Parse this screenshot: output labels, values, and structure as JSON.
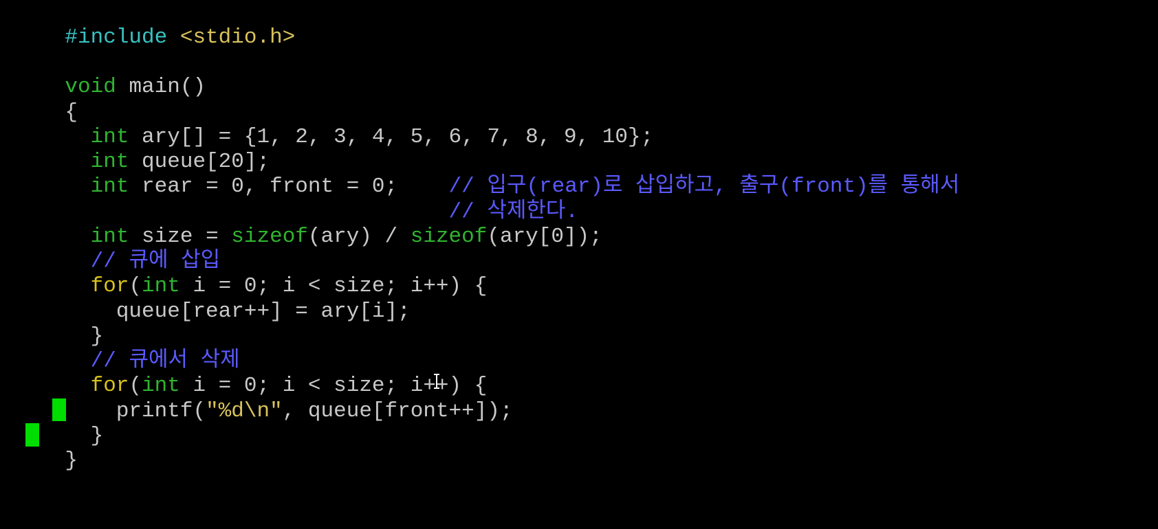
{
  "editor": {
    "lines": [
      {
        "parts": [
          "#include",
          " <stdio.h>"
        ]
      },
      {
        "parts": []
      },
      {
        "parts": [
          "void",
          " main()"
        ]
      },
      {
        "parts": [
          "{"
        ]
      },
      {
        "parts": [
          "  ",
          "int",
          " ary[] = {1, 2, 3, 4, 5, 6, 7, 8, 9, 10};"
        ]
      },
      {
        "parts": [
          "  ",
          "int",
          " queue[20];"
        ]
      },
      {
        "parts": [
          "  ",
          "int",
          " rear = 0, front = 0;    ",
          "// 입구(rear)로 삽입하고, 출구(front)를 통해서"
        ]
      },
      {
        "parts": [
          "                              ",
          "// 삭제한다."
        ]
      },
      {
        "parts": [
          "  ",
          "int",
          " size = ",
          "sizeof",
          "(ary) / ",
          "sizeof",
          "(ary[0]);"
        ]
      },
      {
        "parts": [
          "  ",
          "// 큐에 삽입"
        ]
      },
      {
        "parts": [
          "  ",
          "for",
          "(",
          "int",
          " i = 0; i < size; i++) {"
        ]
      },
      {
        "parts": [
          "    queue[rear++] = ary[i];"
        ]
      },
      {
        "parts": [
          "  }"
        ]
      },
      {
        "parts": [
          "  ",
          "// 큐에서 삭제"
        ]
      },
      {
        "parts": [
          "  ",
          "for",
          "(",
          "int",
          " i = 0; i < size; i++) {"
        ]
      },
      {
        "parts": [
          "    printf(",
          "\"",
          "%d\\n",
          "\"",
          ", queue[front++]);"
        ]
      },
      {
        "parts": [
          "  }"
        ]
      },
      {
        "parts": [
          "}"
        ]
      }
    ],
    "colors": {
      "background": "#000000",
      "keyword": "#2fb52f",
      "preprocessor": "#39c2c2",
      "include_path": "#d9c25c",
      "control": "#d8c21c",
      "string": "#d9c25c",
      "text": "#c8c8c8",
      "comment": "#5a5aff",
      "cursor": "#00dd00"
    }
  }
}
